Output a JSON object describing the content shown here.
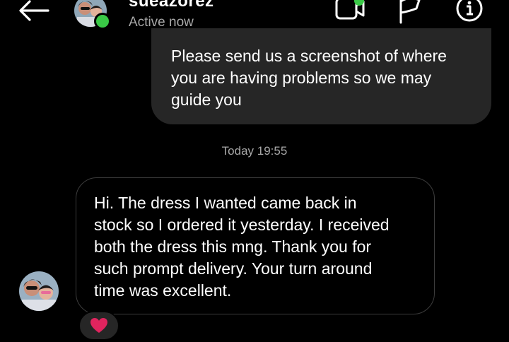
{
  "header": {
    "back_icon": "arrow-left-icon",
    "contact_name": "sueazorez",
    "status": "Active now",
    "online_color": "#3ac947",
    "actions": [
      {
        "name": "video-call",
        "icon": "video-camera-icon"
      },
      {
        "name": "report",
        "icon": "flag-icon"
      },
      {
        "name": "info",
        "icon": "info-icon"
      }
    ]
  },
  "messages": {
    "outgoing": {
      "text": "Please send us a screenshot of where\nyou are having problems so we may\nguide you",
      "bubble_color": "#262626"
    },
    "timestamp": "Today 19:55",
    "incoming": {
      "text": "Hi. The dress I wanted came back in\nstock so I ordered it yesterday.  I received\nboth the dress this mng. Thank you for\nsuch prompt delivery. Your turn around\ntime was excellent.",
      "border_color": "#3c3c3c",
      "reaction": "heart-icon",
      "reaction_color": "#e0245e"
    }
  },
  "colors": {
    "background": "#000000",
    "secondary_text": "#a8a8a8"
  }
}
